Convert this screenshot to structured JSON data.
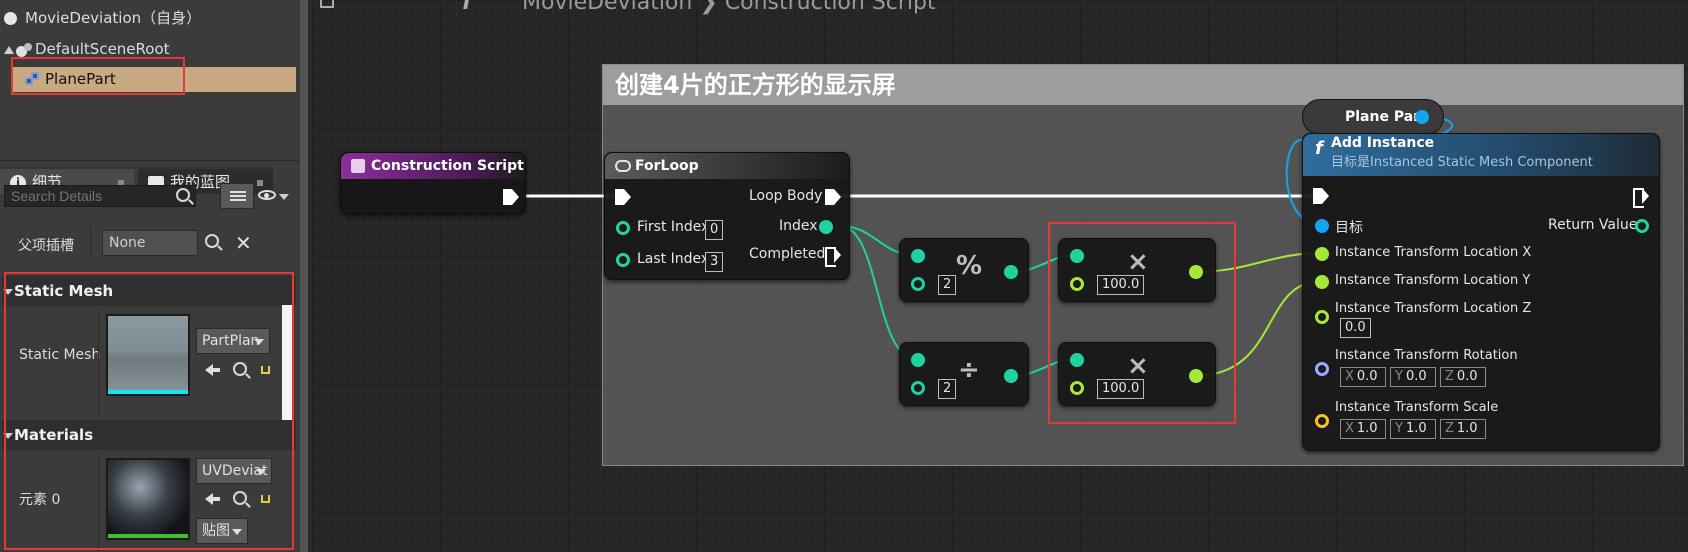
{
  "components": {
    "root_self": "MovieDeviation（自身）",
    "scene_root": "DefaultSceneRoot",
    "plane_part": "PlanePart"
  },
  "tabs": [
    {
      "label": "细节",
      "icon": "info-icon"
    },
    {
      "label": "我的蓝图",
      "icon": "book-icon"
    }
  ],
  "details": {
    "search_placeholder": "Search Details",
    "parent_socket_label": "父项插槽",
    "parent_socket_value": "None",
    "static_mesh_section": "Static Mesh",
    "static_mesh_label": "Static Mesh",
    "static_mesh_value": "PartPlan",
    "materials_section": "Materials",
    "element_label": "元素 0",
    "material_value": "UVDeviat",
    "texture_button": "贴图"
  },
  "breadcrumb": {
    "text": "MovieDeviation ❯ Construction Script"
  },
  "comment": {
    "title": "创建4片的正方形的显示屏"
  },
  "nodes": {
    "construction_script": {
      "title": "Construction Script"
    },
    "forloop": {
      "title": "ForLoop",
      "first_index_label": "First Index",
      "first_index_value": "0",
      "last_index_label": "Last Index",
      "last_index_value": "3",
      "loop_body": "Loop Body",
      "index": "Index",
      "completed": "Completed"
    },
    "mod": {
      "b_value": "2",
      "symbol": "%"
    },
    "divide": {
      "b_value": "2",
      "symbol": "÷"
    },
    "multiply_1": {
      "b_value": "100.0",
      "symbol": "×"
    },
    "multiply_2": {
      "b_value": "100.0",
      "symbol": "×"
    },
    "plane_part_var": {
      "label": "Plane Part"
    },
    "add_instance": {
      "title": "Add Instance",
      "subtitle": "目标是Instanced Static Mesh Component",
      "target": "目标",
      "return_value": "Return Value",
      "loc_x": "Instance Transform Location X",
      "loc_y": "Instance Transform Location Y",
      "loc_z": "Instance Transform Location Z",
      "loc_z_value": "0.0",
      "rotation": "Instance Transform Rotation",
      "rot_x": "0.0",
      "rot_y": "0.0",
      "rot_z": "0.0",
      "scale": "Instance Transform Scale",
      "scale_x": "1.0",
      "scale_y": "1.0",
      "scale_z": "1.0",
      "axis_x": "X",
      "axis_y": "Y",
      "axis_z": "Z"
    }
  },
  "colors": {
    "exec": "#ffffff",
    "int_pin": "#1fd2a2",
    "float_pin": "#a5e83a",
    "object_pin": "#14a4f0",
    "rotator_pin": "#9ea8ff",
    "vector_pin": "#f6c128",
    "function_header": "#2f6d9c",
    "event_header": "#7b2c8a",
    "selection": "#c9a981",
    "highlight_box": "#e53935"
  }
}
